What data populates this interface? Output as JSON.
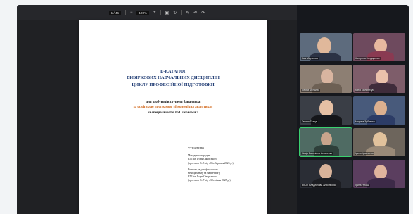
{
  "toolbar": {
    "page_current": "1",
    "page_total": "/ 46",
    "zoom": "100%",
    "minus_icon": "minus-icon",
    "plus_icon": "plus-icon"
  },
  "document": {
    "title_lines": [
      "Ф-КАТАЛОГ",
      "ВИБІРКОВИХ НАВЧАЛЬНИХ ДИСЦИПЛІН",
      "ЦИКЛУ ПРОФЕСІЙНОЇ ПІДГОТОВКИ"
    ],
    "for_line": "для здобувачів ступеня бакалавра",
    "program_line": "за освітньою програмою «Економічна аналітика»",
    "specialty_line": "за спеціальністю 051 Економіка",
    "approved_head": "УХВАЛЕНО",
    "approved_lines": [
      "Методичною радою",
      "КПІ ім. Ігоря Сікорського",
      "(протокол № 5 від «06» березня 2025 р.)",
      "",
      "Вченою радою факультету",
      "менеджменту та маркетингу",
      "КПІ ім. Ігоря Сікорського",
      "(протокол № 7 від «30» січня 2025 р.)"
    ]
  },
  "participants": [
    {
      "label": "Івак Мартинюк",
      "bg": "#5d6b7d"
    },
    {
      "label": "Катерина Бондаренко",
      "bg": "#6e4a5e"
    },
    {
      "label": "Сергій Мельник",
      "bg": "#8d7f73"
    },
    {
      "label": "Юлія Мельничук",
      "bg": "#7e5d6a"
    },
    {
      "label": "Тетяна Ткачук",
      "bg": "#3a3e46"
    },
    {
      "label": "Марина Зубченко",
      "bg": "#485a7b"
    },
    {
      "label": "Надія Василівна Астапенко",
      "bg": "#4f6b63"
    },
    {
      "label": "Ірина Кравченко",
      "bg": "#6d655c"
    },
    {
      "label": "ЕК-22 Владислава Анисимова",
      "bg": "#2a2d35"
    },
    {
      "label": "Ірина Лукаш",
      "bg": "#5b3e5f"
    }
  ]
}
